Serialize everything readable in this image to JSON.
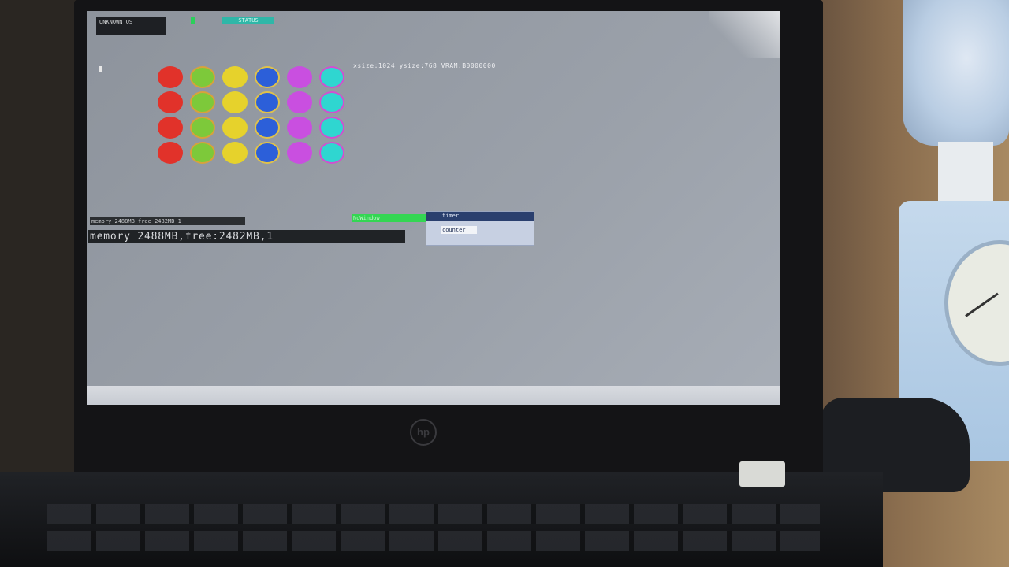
{
  "screen": {
    "topbar": {
      "logo_text": "UNKNOWN OS",
      "status_text": "STATUS"
    },
    "info_line": "xsize:1024 ysize:768 VRAM:B0000000",
    "memory_small": "memory 2488MB free 2482MB 1",
    "memory_big": "memory 2488MB,free:2482MB,1",
    "green_bar_text": "NoWindow",
    "dialog": {
      "title": "timer",
      "field_text": "counter"
    },
    "dot_grid": {
      "rows": 4,
      "colors": [
        {
          "name": "red",
          "fill": "#e1322a",
          "ring": "#e1322a"
        },
        {
          "name": "green",
          "fill": "#7dc93a",
          "ring": "#d8a23a"
        },
        {
          "name": "yellow",
          "fill": "#e6d22c",
          "ring": "#e6d22c"
        },
        {
          "name": "blue",
          "fill": "#2c5fd9",
          "ring": "#e0c24a"
        },
        {
          "name": "magenta",
          "fill": "#c94fe0",
          "ring": "#c94fe0"
        },
        {
          "name": "cyan",
          "fill": "#2fd6d0",
          "ring": "#d24fd0"
        }
      ]
    }
  },
  "laptop": {
    "brand": "hp"
  }
}
